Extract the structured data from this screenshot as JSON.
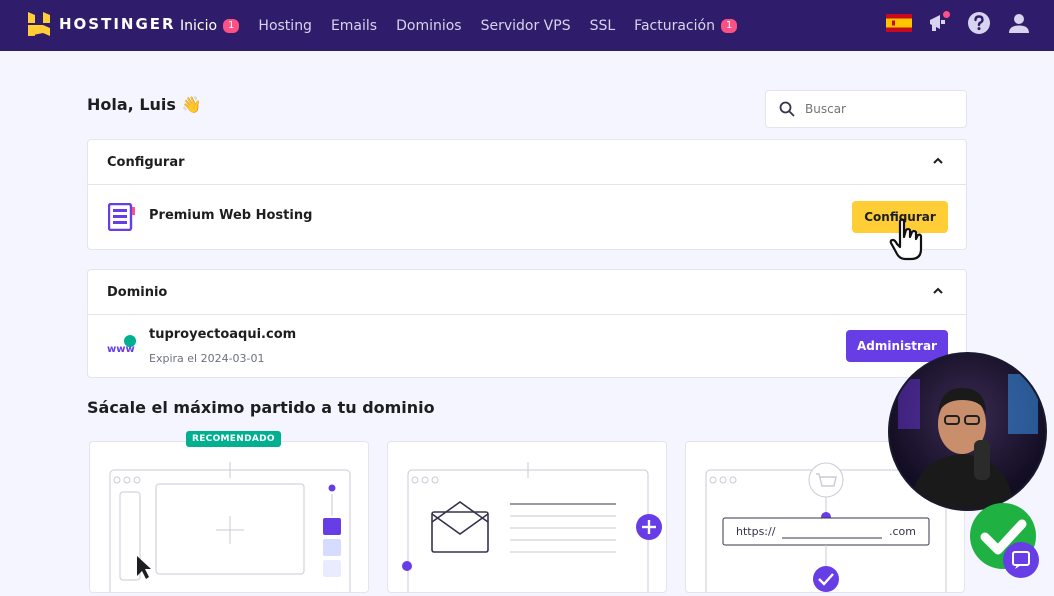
{
  "brand": {
    "name": "HOSTINGER"
  },
  "nav": {
    "items": [
      {
        "label": "Inicio",
        "badge": "1"
      },
      {
        "label": "Hosting"
      },
      {
        "label": "Emails"
      },
      {
        "label": "Dominios"
      },
      {
        "label": "Servidor VPS"
      },
      {
        "label": "SSL"
      },
      {
        "label": "Facturación",
        "badge": "1"
      }
    ]
  },
  "greeting": "Hola, Luis 👋",
  "search": {
    "placeholder": "Buscar",
    "value": ""
  },
  "setup_card": {
    "title": "Configurar",
    "item": "Premium Web Hosting",
    "button": "Configurar"
  },
  "domain_card": {
    "title": "Dominio",
    "domain": "tuproyectoaqui.com",
    "expires": "Expira el 2024-03-01",
    "button": "Administrar"
  },
  "section": {
    "title": "Sácale el máximo partido a tu dominio"
  },
  "promos": [
    {
      "badge": "RECOMENDADO"
    },
    {},
    {
      "url_prefix": "https://",
      "url_suffix": ".com"
    }
  ],
  "colors": {
    "nav_bg": "#2f1c6a",
    "accent": "#673de6",
    "yellow": "#ffcd35",
    "badge": "#fc5185",
    "green": "#00b090"
  },
  "icons": [
    "hostinger-logo-icon",
    "spain-flag-icon",
    "megaphone-icon",
    "help-icon",
    "user-icon",
    "search-icon",
    "chevron-up-icon",
    "hosting-icon",
    "www-icon",
    "hand-cursor-icon",
    "checkmark-icon",
    "chat-icon"
  ]
}
